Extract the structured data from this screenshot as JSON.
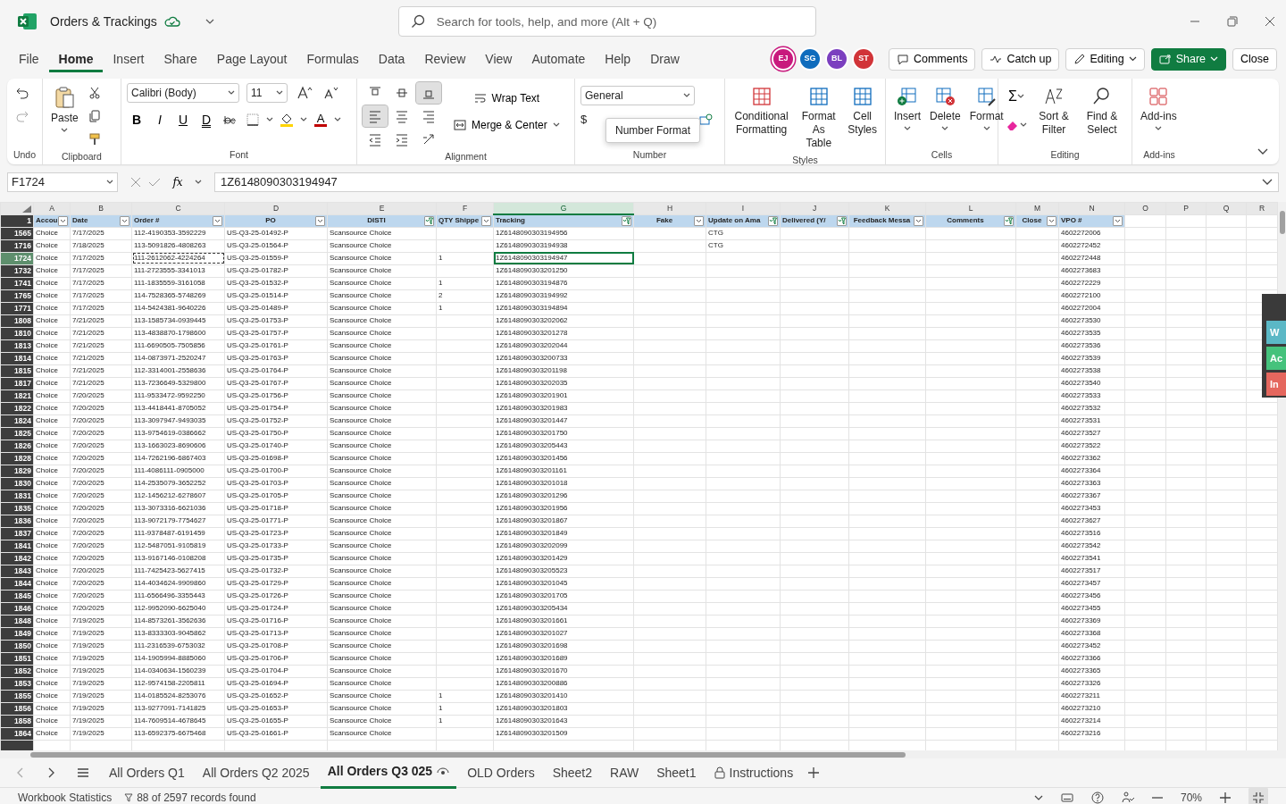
{
  "window": {
    "title": "Orders & Trackings",
    "search_placeholder": "Search for tools, help, and more (Alt + Q)"
  },
  "menu_tabs": [
    {
      "label": "File",
      "selected": false
    },
    {
      "label": "Home",
      "selected": true
    },
    {
      "label": "Insert",
      "selected": false
    },
    {
      "label": "Share",
      "selected": false
    },
    {
      "label": "Page Layout",
      "selected": false
    },
    {
      "label": "Formulas",
      "selected": false
    },
    {
      "label": "Data",
      "selected": false
    },
    {
      "label": "Review",
      "selected": false
    },
    {
      "label": "View",
      "selected": false
    },
    {
      "label": "Automate",
      "selected": false
    },
    {
      "label": "Help",
      "selected": false
    },
    {
      "label": "Draw",
      "selected": false
    }
  ],
  "avatars": [
    {
      "initials": "EJ",
      "color": "#c8197d"
    },
    {
      "initials": "SG",
      "color": "#0f6cbd"
    },
    {
      "initials": "BL",
      "color": "#7b3fbf"
    },
    {
      "initials": "ST",
      "color": "#d13438"
    }
  ],
  "header_buttons": [
    {
      "kind": "comments",
      "label": "Comments"
    },
    {
      "kind": "catchup",
      "label": "Catch up"
    },
    {
      "kind": "editing",
      "label": "Editing"
    },
    {
      "kind": "share",
      "label": "Share"
    },
    {
      "kind": "plain",
      "label": "Close"
    }
  ],
  "ribbon": {
    "groups": [
      {
        "kind": "undo",
        "label": "Undo"
      },
      {
        "kind": "clipboard",
        "label": "Clipboard",
        "paste": "Paste"
      },
      {
        "kind": "font",
        "label": "Font",
        "font_name": "Calibri (Body)",
        "font_size": "11",
        "style_buttons": [
          "B",
          "I",
          "U",
          "D"
        ],
        "color_letter": "A"
      },
      {
        "kind": "alignment",
        "label": "Alignment",
        "wrap": "Wrap Text",
        "merge": "Merge & Center",
        "vertical": [
          {
            "selected": false
          },
          {
            "selected": false
          },
          {
            "selected": true
          }
        ],
        "horizontal": [
          {
            "selected": true
          },
          {
            "selected": false
          },
          {
            "selected": false
          }
        ]
      },
      {
        "kind": "number",
        "label": "Number",
        "format": "General",
        "tooltip": "Number Format",
        "currency": "$"
      },
      {
        "kind": "styles",
        "label": "Styles",
        "buttons": [
          "Conditional Formatting",
          "Format As Table",
          "Cell Styles"
        ]
      },
      {
        "kind": "cells",
        "label": "Cells",
        "buttons": [
          "Insert",
          "Delete",
          "Format"
        ]
      },
      {
        "kind": "editing",
        "label": "Editing",
        "sigma": "Σ",
        "buttons": [
          "Sort & Filter",
          "Find & Select"
        ]
      },
      {
        "kind": "addins",
        "label": "Add-ins",
        "button": "Add-ins"
      }
    ]
  },
  "formula_bar": {
    "name_box": "F1724",
    "fx": "fx",
    "value": "1Z6148090303194947"
  },
  "column_letters": [
    {
      "letter": "A",
      "selected": false
    },
    {
      "letter": "B",
      "selected": false
    },
    {
      "letter": "C",
      "selected": false
    },
    {
      "letter": "D",
      "selected": false
    },
    {
      "letter": "E",
      "selected": false
    },
    {
      "letter": "F",
      "selected": false
    },
    {
      "letter": "G",
      "selected": true
    },
    {
      "letter": "H",
      "selected": false
    },
    {
      "letter": "I",
      "selected": false
    },
    {
      "letter": "J",
      "selected": false
    },
    {
      "letter": "K",
      "selected": false
    },
    {
      "letter": "L",
      "selected": false
    },
    {
      "letter": "M",
      "selected": false
    },
    {
      "letter": "N",
      "selected": false
    },
    {
      "letter": "O",
      "selected": false
    },
    {
      "letter": "P",
      "selected": false
    },
    {
      "letter": "Q",
      "selected": false
    },
    {
      "letter": "R",
      "selected": false
    }
  ],
  "header_row": {
    "number": "1",
    "columns": [
      {
        "label": "Accou",
        "filtered": false
      },
      {
        "label": "Date",
        "filtered": false
      },
      {
        "label": "Order #",
        "filtered": false
      },
      {
        "label": "PO",
        "filtered": false
      },
      {
        "label": "DISTI",
        "filtered": true
      },
      {
        "label": "QTY Shippe",
        "filtered": false
      },
      {
        "label": "Tracking",
        "filtered": true
      },
      {
        "label": "Fake",
        "filtered": false
      },
      {
        "label": "Update on Ama",
        "filtered": true
      },
      {
        "label": "Delivered (Y/",
        "filtered": true
      },
      {
        "label": "Feedback Messa",
        "filtered": false
      },
      {
        "label": "Comments",
        "filtered": true
      },
      {
        "label": "Close",
        "filtered": false
      },
      {
        "label": "VPO #",
        "filtered": false
      }
    ]
  },
  "rows": [
    {
      "number": "1565",
      "selected": false,
      "account": "Choice",
      "date": "7/17/2025",
      "order": "112-4190353-3592229",
      "po": "US-Q3-25-01492-P",
      "disti": "Scansource Choice",
      "tracking": "1Z6148090303194956",
      "update_on_amazon": "CTG",
      "vpo": "4602272006"
    },
    {
      "number": "1716",
      "selected": false,
      "account": "Choice",
      "date": "7/18/2025",
      "order": "113-5091826-4808263",
      "po": "US-Q3-25-01564-P",
      "disti": "Scansource Choice",
      "tracking": "1Z6148090303194938",
      "update_on_amazon": "CTG",
      "vpo": "4602272452"
    },
    {
      "number": "1724",
      "selected": true,
      "account": "Choice",
      "date": "7/17/2025",
      "order": "111-2612062-4224264",
      "po": "US-Q3-25-01559-P",
      "disti": "Scansource Choice",
      "qty": "1",
      "tracking": "1Z6148090303194947",
      "vpo": "4602272448"
    },
    {
      "number": "1732",
      "selected": false,
      "account": "Choice",
      "date": "7/17/2025",
      "order": "111-2723555-3341013",
      "po": "US-Q3-25-01782-P",
      "disti": "Scansource Choice",
      "tracking": "1Z6148090303201250",
      "vpo": "4602273683"
    },
    {
      "number": "1741",
      "selected": false,
      "account": "Choice",
      "date": "7/17/2025",
      "order": "111-1835559-3161058",
      "po": "US-Q3-25-01532-P",
      "disti": "Scansource Choice",
      "qty": "1",
      "tracking": "1Z6148090303194876",
      "vpo": "4602272229"
    },
    {
      "number": "1765",
      "selected": false,
      "account": "Choice",
      "date": "7/17/2025",
      "order": "114-7528365-5748269",
      "po": "US-Q3-25-01514-P",
      "disti": "Scansource Choice",
      "qty": "2",
      "tracking": "1Z6148090303194992",
      "vpo": "4602272100"
    },
    {
      "number": "1771",
      "selected": false,
      "account": "Choice",
      "date": "7/17/2025",
      "order": "114-5424381-9640226",
      "po": "US-Q3-25-01489-P",
      "disti": "Scansource Choice",
      "qty": "1",
      "tracking": "1Z6148090303194894",
      "vpo": "4602272004"
    },
    {
      "number": "1808",
      "selected": false,
      "account": "Choice",
      "date": "7/21/2025",
      "order": "113-1585734-0939445",
      "po": "US-Q3-25-01753-P",
      "disti": "Scansource Choice",
      "tracking": "1Z6148090303202062",
      "vpo": "4602273530"
    },
    {
      "number": "1810",
      "selected": false,
      "account": "Choice",
      "date": "7/21/2025",
      "order": "113-4838870-1798600",
      "po": "US-Q3-25-01757-P",
      "disti": "Scansource Choice",
      "tracking": "1Z6148090303201278",
      "vpo": "4602273535"
    },
    {
      "number": "1813",
      "selected": false,
      "account": "Choice",
      "date": "7/21/2025",
      "order": "111-6690505-7505856",
      "po": "US-Q3-25-01761-P",
      "disti": "Scansource Choice",
      "tracking": "1Z6148090303202044",
      "vpo": "4602273536"
    },
    {
      "number": "1814",
      "selected": false,
      "account": "Choice",
      "date": "7/21/2025",
      "order": "114-0873971-2520247",
      "po": "US-Q3-25-01763-P",
      "disti": "Scansource Choice",
      "tracking": "1Z6148090303200733",
      "vpo": "4602273539"
    },
    {
      "number": "1815",
      "selected": false,
      "account": "Choice",
      "date": "7/21/2025",
      "order": "112-3314001-2558636",
      "po": "US-Q3-25-01764-P",
      "disti": "Scansource Choice",
      "tracking": "1Z6148090303201198",
      "vpo": "4602273538"
    },
    {
      "number": "1817",
      "selected": false,
      "account": "Choice",
      "date": "7/21/2025",
      "order": "113-7236649-5329800",
      "po": "US-Q3-25-01767-P",
      "disti": "Scansource Choice",
      "tracking": "1Z6148090303202035",
      "vpo": "4602273540"
    },
    {
      "number": "1821",
      "selected": false,
      "account": "Choice",
      "date": "7/20/2025",
      "order": "111-9533472-9592250",
      "po": "US-Q3-25-01756-P",
      "disti": "Scansource Choice",
      "tracking": "1Z6148090303201901",
      "vpo": "4602273533"
    },
    {
      "number": "1822",
      "selected": false,
      "account": "Choice",
      "date": "7/20/2025",
      "order": "113-4418441-8705052",
      "po": "US-Q3-25-01754-P",
      "disti": "Scansource Choice",
      "tracking": "1Z6148090303201983",
      "vpo": "4602273532"
    },
    {
      "number": "1824",
      "selected": false,
      "account": "Choice",
      "date": "7/20/2025",
      "order": "113-3097947-9493035",
      "po": "US-Q3-25-01752-P",
      "disti": "Scansource Choice",
      "tracking": "1Z6148090303201447",
      "vpo": "4602273531"
    },
    {
      "number": "1825",
      "selected": false,
      "account": "Choice",
      "date": "7/20/2025",
      "order": "113-9754619-0386662",
      "po": "US-Q3-25-01750-P",
      "disti": "Scansource Choice",
      "tracking": "1Z6148090303201750",
      "vpo": "4602273527"
    },
    {
      "number": "1826",
      "selected": false,
      "account": "Choice",
      "date": "7/20/2025",
      "order": "113-1663023-8690606",
      "po": "US-Q3-25-01740-P",
      "disti": "Scansource Choice",
      "tracking": "1Z6148090303205443",
      "vpo": "4602273522"
    },
    {
      "number": "1828",
      "selected": false,
      "account": "Choice",
      "date": "7/20/2025",
      "order": "114-7262196-6867403",
      "po": "US-Q3-25-01698-P",
      "disti": "Scansource Choice",
      "tracking": "1Z6148090303201456",
      "vpo": "4602273362"
    },
    {
      "number": "1829",
      "selected": false,
      "account": "Choice",
      "date": "7/20/2025",
      "order": "111-4086111-0905000",
      "po": "US-Q3-25-01700-P",
      "disti": "Scansource Choice",
      "tracking": "1Z6148090303201161",
      "vpo": "4602273364"
    },
    {
      "number": "1830",
      "selected": false,
      "account": "Choice",
      "date": "7/20/2025",
      "order": "114-2535079-3652252",
      "po": "US-Q3-25-01703-P",
      "disti": "Scansource Choice",
      "tracking": "1Z6148090303201018",
      "vpo": "4602273363"
    },
    {
      "number": "1831",
      "selected": false,
      "account": "Choice",
      "date": "7/20/2025",
      "order": "112-1456212-6278607",
      "po": "US-Q3-25-01705-P",
      "disti": "Scansource Choice",
      "tracking": "1Z6148090303201296",
      "vpo": "4602273367"
    },
    {
      "number": "1835",
      "selected": false,
      "account": "Choice",
      "date": "7/20/2025",
      "order": "113-3073316-6621036",
      "po": "US-Q3-25-01718-P",
      "disti": "Scansource Choice",
      "tracking": "1Z6148090303201956",
      "vpo": "4602273453"
    },
    {
      "number": "1836",
      "selected": false,
      "account": "Choice",
      "date": "7/20/2025",
      "order": "113-9072179-7754627",
      "po": "US-Q3-25-01771-P",
      "disti": "Scansource Choice",
      "tracking": "1Z6148090303201867",
      "vpo": "4602273627"
    },
    {
      "number": "1837",
      "selected": false,
      "account": "Choice",
      "date": "7/20/2025",
      "order": "111-9378487-6191459",
      "po": "US-Q3-25-01723-P",
      "disti": "Scansource Choice",
      "tracking": "1Z6148090303201849",
      "vpo": "4602273516"
    },
    {
      "number": "1841",
      "selected": false,
      "account": "Choice",
      "date": "7/20/2025",
      "order": "112-5487051-9105819",
      "po": "US-Q3-25-01733-P",
      "disti": "Scansource Choice",
      "tracking": "1Z6148090303202099",
      "vpo": "4602273542"
    },
    {
      "number": "1842",
      "selected": false,
      "account": "Choice",
      "date": "7/20/2025",
      "order": "113-9167146-0108208",
      "po": "US-Q3-25-01735-P",
      "disti": "Scansource Choice",
      "tracking": "1Z6148090303201429",
      "vpo": "4602273541"
    },
    {
      "number": "1843",
      "selected": false,
      "account": "Choice",
      "date": "7/20/2025",
      "order": "111-7425423-5627415",
      "po": "US-Q3-25-01732-P",
      "disti": "Scansource Choice",
      "tracking": "1Z6148090303205523",
      "vpo": "4602273517"
    },
    {
      "number": "1844",
      "selected": false,
      "account": "Choice",
      "date": "7/20/2025",
      "order": "114-4034624-9909860",
      "po": "US-Q3-25-01729-P",
      "disti": "Scansource Choice",
      "tracking": "1Z6148090303201045",
      "vpo": "4602273457"
    },
    {
      "number": "1845",
      "selected": false,
      "account": "Choice",
      "date": "7/20/2025",
      "order": "111-6566496-3355443",
      "po": "US-Q3-25-01726-P",
      "disti": "Scansource Choice",
      "tracking": "1Z6148090303201705",
      "vpo": "4602273456"
    },
    {
      "number": "1846",
      "selected": false,
      "account": "Choice",
      "date": "7/20/2025",
      "order": "112-9952090-6625040",
      "po": "US-Q3-25-01724-P",
      "disti": "Scansource Choice",
      "tracking": "1Z6148090303205434",
      "vpo": "4602273455"
    },
    {
      "number": "1848",
      "selected": false,
      "account": "Choice",
      "date": "7/19/2025",
      "order": "114-8573261-3562636",
      "po": "US-Q3-25-01716-P",
      "disti": "Scansource Choice",
      "tracking": "1Z6148090303201661",
      "vpo": "4602273369"
    },
    {
      "number": "1849",
      "selected": false,
      "account": "Choice",
      "date": "7/19/2025",
      "order": "113-8333303-9045862",
      "po": "US-Q3-25-01713-P",
      "disti": "Scansource Choice",
      "tracking": "1Z6148090303201027",
      "vpo": "4602273368"
    },
    {
      "number": "1850",
      "selected": false,
      "account": "Choice",
      "date": "7/19/2025",
      "order": "111-2316539-6753032",
      "po": "US-Q3-25-01708-P",
      "disti": "Scansource Choice",
      "tracking": "1Z6148090303201698",
      "vpo": "4602273452"
    },
    {
      "number": "1851",
      "selected": false,
      "account": "Choice",
      "date": "7/19/2025",
      "order": "114-1905994-8885060",
      "po": "US-Q3-25-01706-P",
      "disti": "Scansource Choice",
      "tracking": "1Z6148090303201689",
      "vpo": "4602273366"
    },
    {
      "number": "1852",
      "selected": false,
      "account": "Choice",
      "date": "7/19/2025",
      "order": "114-0340634-1560239",
      "po": "US-Q3-25-01704-P",
      "disti": "Scansource Choice",
      "tracking": "1Z6148090303201670",
      "vpo": "4602273365"
    },
    {
      "number": "1853",
      "selected": false,
      "account": "Choice",
      "date": "7/19/2025",
      "order": "112-9574158-2205811",
      "po": "US-Q3-25-01694-P",
      "disti": "Scansource Choice",
      "tracking": "1Z6148090303200886",
      "vpo": "4602273326"
    },
    {
      "number": "1855",
      "selected": false,
      "account": "Choice",
      "date": "7/19/2025",
      "order": "114-0185524-8253076",
      "po": "US-Q3-25-01652-P",
      "disti": "Scansource Choice",
      "qty": "1",
      "tracking": "1Z6148090303201410",
      "vpo": "4602273211"
    },
    {
      "number": "1856",
      "selected": false,
      "account": "Choice",
      "date": "7/19/2025",
      "order": "113-9277091-7141825",
      "po": "US-Q3-25-01653-P",
      "disti": "Scansource Choice",
      "qty": "1",
      "tracking": "1Z6148090303201803",
      "vpo": "4602273210"
    },
    {
      "number": "1858",
      "selected": false,
      "account": "Choice",
      "date": "7/19/2025",
      "order": "114-7609514-4678645",
      "po": "US-Q3-25-01655-P",
      "disti": "Scansource Choice",
      "qty": "1",
      "tracking": "1Z6148090303201643",
      "vpo": "4602273214"
    },
    {
      "number": "1864",
      "selected": false,
      "account": "Choice",
      "date": "7/19/2025",
      "order": "113-6592375-6675468",
      "po": "US-Q3-25-01661-P",
      "disti": "Scansource Choice",
      "tracking": "1Z6148090303201509",
      "vpo": "4602273216"
    }
  ],
  "side_panel": [
    {
      "label": "W",
      "color": "#5bb8c6"
    },
    {
      "label": "Ac",
      "color": "#45c27c"
    },
    {
      "label": "In",
      "color": "#e5675e"
    }
  ],
  "sheet_tabs": [
    {
      "label": "All Orders Q1",
      "selected": false,
      "locked": false
    },
    {
      "label": "All Orders Q2 2025",
      "selected": false,
      "locked": false
    },
    {
      "label": "All Orders Q3 025",
      "selected": true,
      "locked": false
    },
    {
      "label": "OLD Orders",
      "selected": false,
      "locked": false
    },
    {
      "label": "Sheet2",
      "selected": false,
      "locked": false
    },
    {
      "label": "RAW",
      "selected": false,
      "locked": false
    },
    {
      "label": "Sheet1",
      "selected": false,
      "locked": false
    },
    {
      "label": "Instructions",
      "selected": false,
      "locked": true
    }
  ],
  "status_bar": {
    "statistics": "Workbook Statistics",
    "filter_info": "88 of 2597 records found",
    "zoom": "70%"
  }
}
